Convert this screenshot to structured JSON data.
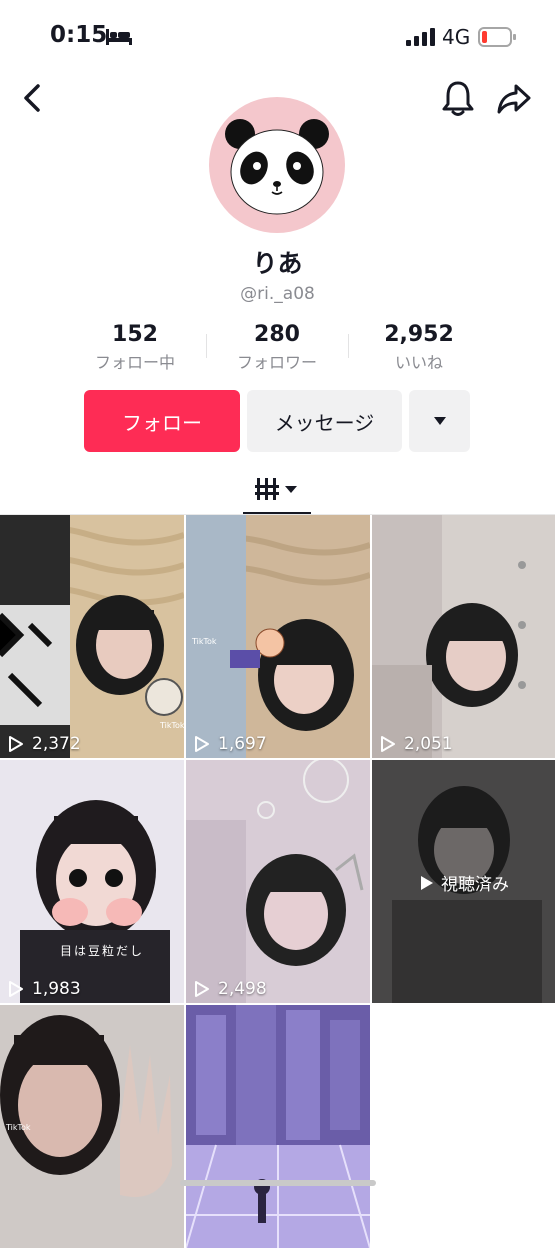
{
  "status_bar": {
    "time": "0:15",
    "network": "4G"
  },
  "profile": {
    "name": "りあ",
    "handle": "@ri._a08"
  },
  "stats": [
    {
      "value": "152",
      "label": "フォロー中"
    },
    {
      "value": "280",
      "label": "フォロワー"
    },
    {
      "value": "2,952",
      "label": "いいね"
    }
  ],
  "actions": {
    "follow_label": "フォロー",
    "message_label": "メッセージ"
  },
  "videos": [
    {
      "views": "2,372",
      "watermark": "TikTok"
    },
    {
      "views": "1,697",
      "watermark": "TikTok"
    },
    {
      "views": "2,051"
    },
    {
      "views": "1,983",
      "caption": "目は豆粒だし"
    },
    {
      "views": "2,498"
    },
    {
      "overlay": "視聴済み"
    },
    {
      "watermark": "TikTok"
    },
    {}
  ],
  "colors": {
    "accent": "#fe2c55",
    "avatar_bg": "#f4c7cc"
  }
}
